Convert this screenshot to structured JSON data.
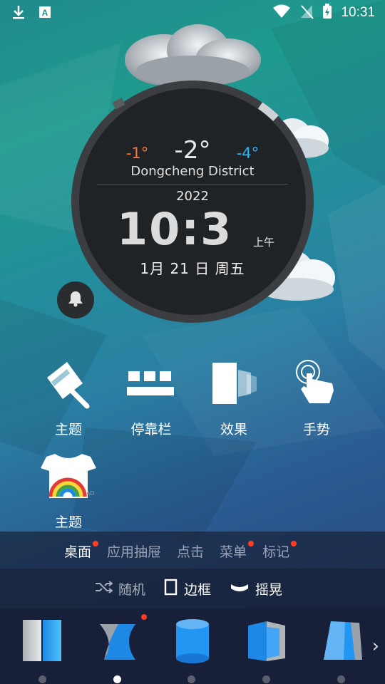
{
  "status_bar": {
    "time": "10:31"
  },
  "weather": {
    "temp_high": "-1°",
    "temp_current": "-2°",
    "temp_low": "-4°",
    "district": "Dongcheng District"
  },
  "clock": {
    "year": "2022",
    "time": "10:3",
    "ampm": "上午",
    "date": "1月 21 日 周五"
  },
  "shortcuts": [
    {
      "label": "主题",
      "icon": "theme-brush-icon"
    },
    {
      "label": "停靠栏",
      "icon": "dock-icon"
    },
    {
      "label": "效果",
      "icon": "effect-panels-icon"
    },
    {
      "label": "手势",
      "icon": "gesture-hand-icon"
    },
    {
      "label": "主题",
      "icon": "tshirt-theme-icon"
    }
  ],
  "tabs": [
    {
      "label": "桌面",
      "active": true,
      "dot": true
    },
    {
      "label": "应用抽屉",
      "active": false,
      "dot": false
    },
    {
      "label": "点击",
      "active": false,
      "dot": false
    },
    {
      "label": "菜单",
      "active": false,
      "dot": true
    },
    {
      "label": "标记",
      "active": false,
      "dot": true
    }
  ],
  "options": [
    {
      "label": "随机",
      "icon": "shuffle-icon"
    },
    {
      "label": "边框",
      "icon": "frame-icon"
    },
    {
      "label": "摇晃",
      "icon": "shake-icon"
    }
  ],
  "colors": {
    "accent_hi": "#ff7043",
    "accent_lo": "#29b6f6",
    "badge": "#ff3d1f"
  }
}
